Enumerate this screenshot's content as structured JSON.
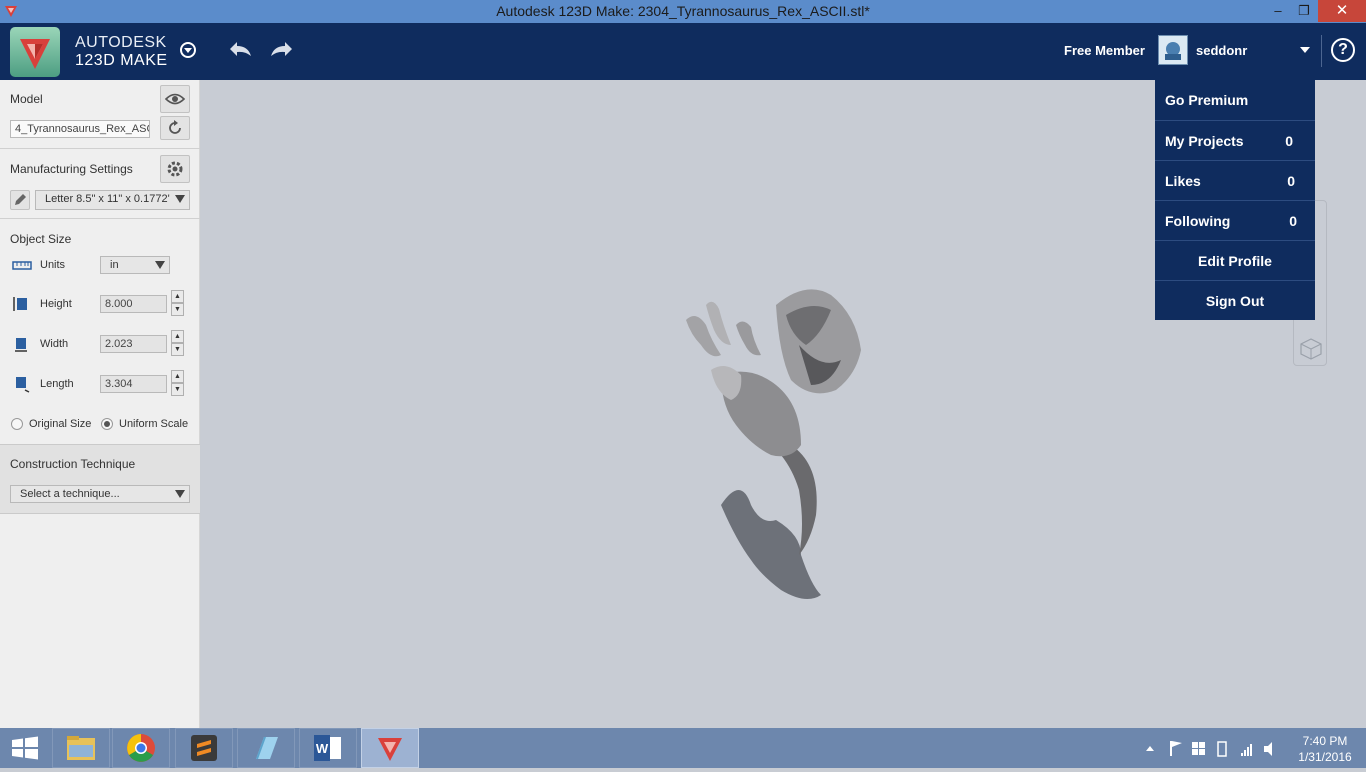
{
  "window": {
    "title": "Autodesk 123D Make: 2304_Tyrannosaurus_Rex_ASCII.stl*",
    "minimize_label": "–",
    "restore_label": "❐",
    "close_label": "✕"
  },
  "header": {
    "brand_line1": "AUTODESK",
    "brand_line2": "123D MAKE",
    "membership": "Free Member",
    "username": "seddonr",
    "help_label": "?"
  },
  "panel": {
    "model_label": "Model",
    "model_file": "4_Tyrannosaurus_Rex_ASC",
    "manufacturing_label": "Manufacturing Settings",
    "manufacturing_value": "Letter 8.5\" x 11\" x 0.1772'",
    "object_size_label": "Object Size",
    "units_label": "Units",
    "units_value": "in",
    "height_label": "Height",
    "height_value": "8.000",
    "width_label": "Width",
    "width_value": "2.023",
    "length_label": "Length",
    "length_value": "3.304",
    "original_size_label": "Original Size",
    "uniform_scale_label": "Uniform Scale",
    "uniform_scale_selected": true,
    "construction_label": "Construction Technique",
    "construction_placeholder": "Select a technique..."
  },
  "user_menu": {
    "go_premium": "Go Premium",
    "my_projects": "My Projects",
    "my_projects_count": "0",
    "likes": "Likes",
    "likes_count": "0",
    "following": "Following",
    "following_count": "0",
    "edit_profile": "Edit Profile",
    "sign_out": "Sign Out"
  },
  "taskbar": {
    "apps": [
      "file-explorer",
      "chrome",
      "sublime-text",
      "notepad",
      "word",
      "123d-make"
    ],
    "active_app": "123d-make",
    "time": "7:40 PM",
    "date": "1/31/2016"
  },
  "colors": {
    "header_bg": "#0f2c5e",
    "titlebar_bg": "#5b8ccb",
    "viewport_bg": "#c8ccd4",
    "close_red": "#c7463a"
  }
}
